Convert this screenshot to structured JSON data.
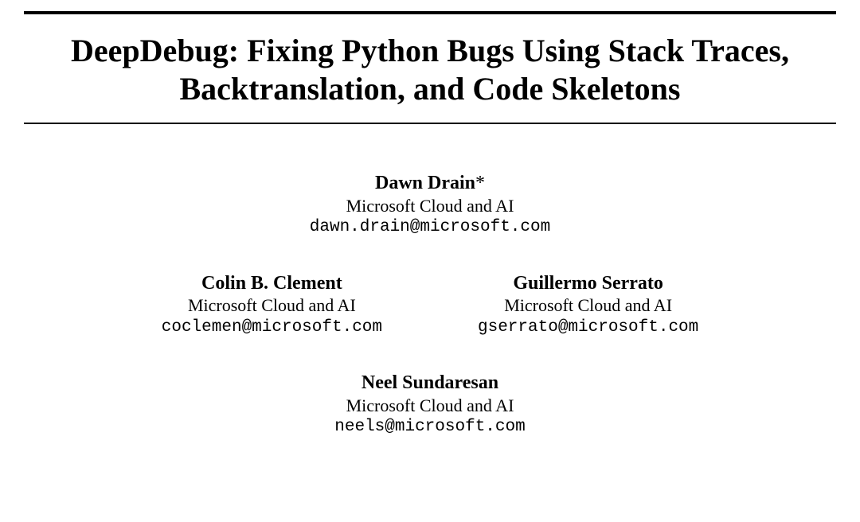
{
  "title": "DeepDebug: Fixing Python Bugs Using Stack Traces, Backtranslation, and Code Skeletons",
  "authors": [
    {
      "name": "Dawn Drain",
      "note": "*",
      "affiliation": "Microsoft Cloud and AI",
      "email": "dawn.drain@microsoft.com"
    },
    {
      "name": "Colin B. Clement",
      "note": "",
      "affiliation": "Microsoft Cloud and AI",
      "email": "coclemen@microsoft.com"
    },
    {
      "name": "Guillermo Serrato",
      "note": "",
      "affiliation": "Microsoft Cloud and AI",
      "email": "gserrato@microsoft.com"
    },
    {
      "name": "Neel Sundaresan",
      "note": "",
      "affiliation": "Microsoft Cloud and AI",
      "email": "neels@microsoft.com"
    }
  ]
}
